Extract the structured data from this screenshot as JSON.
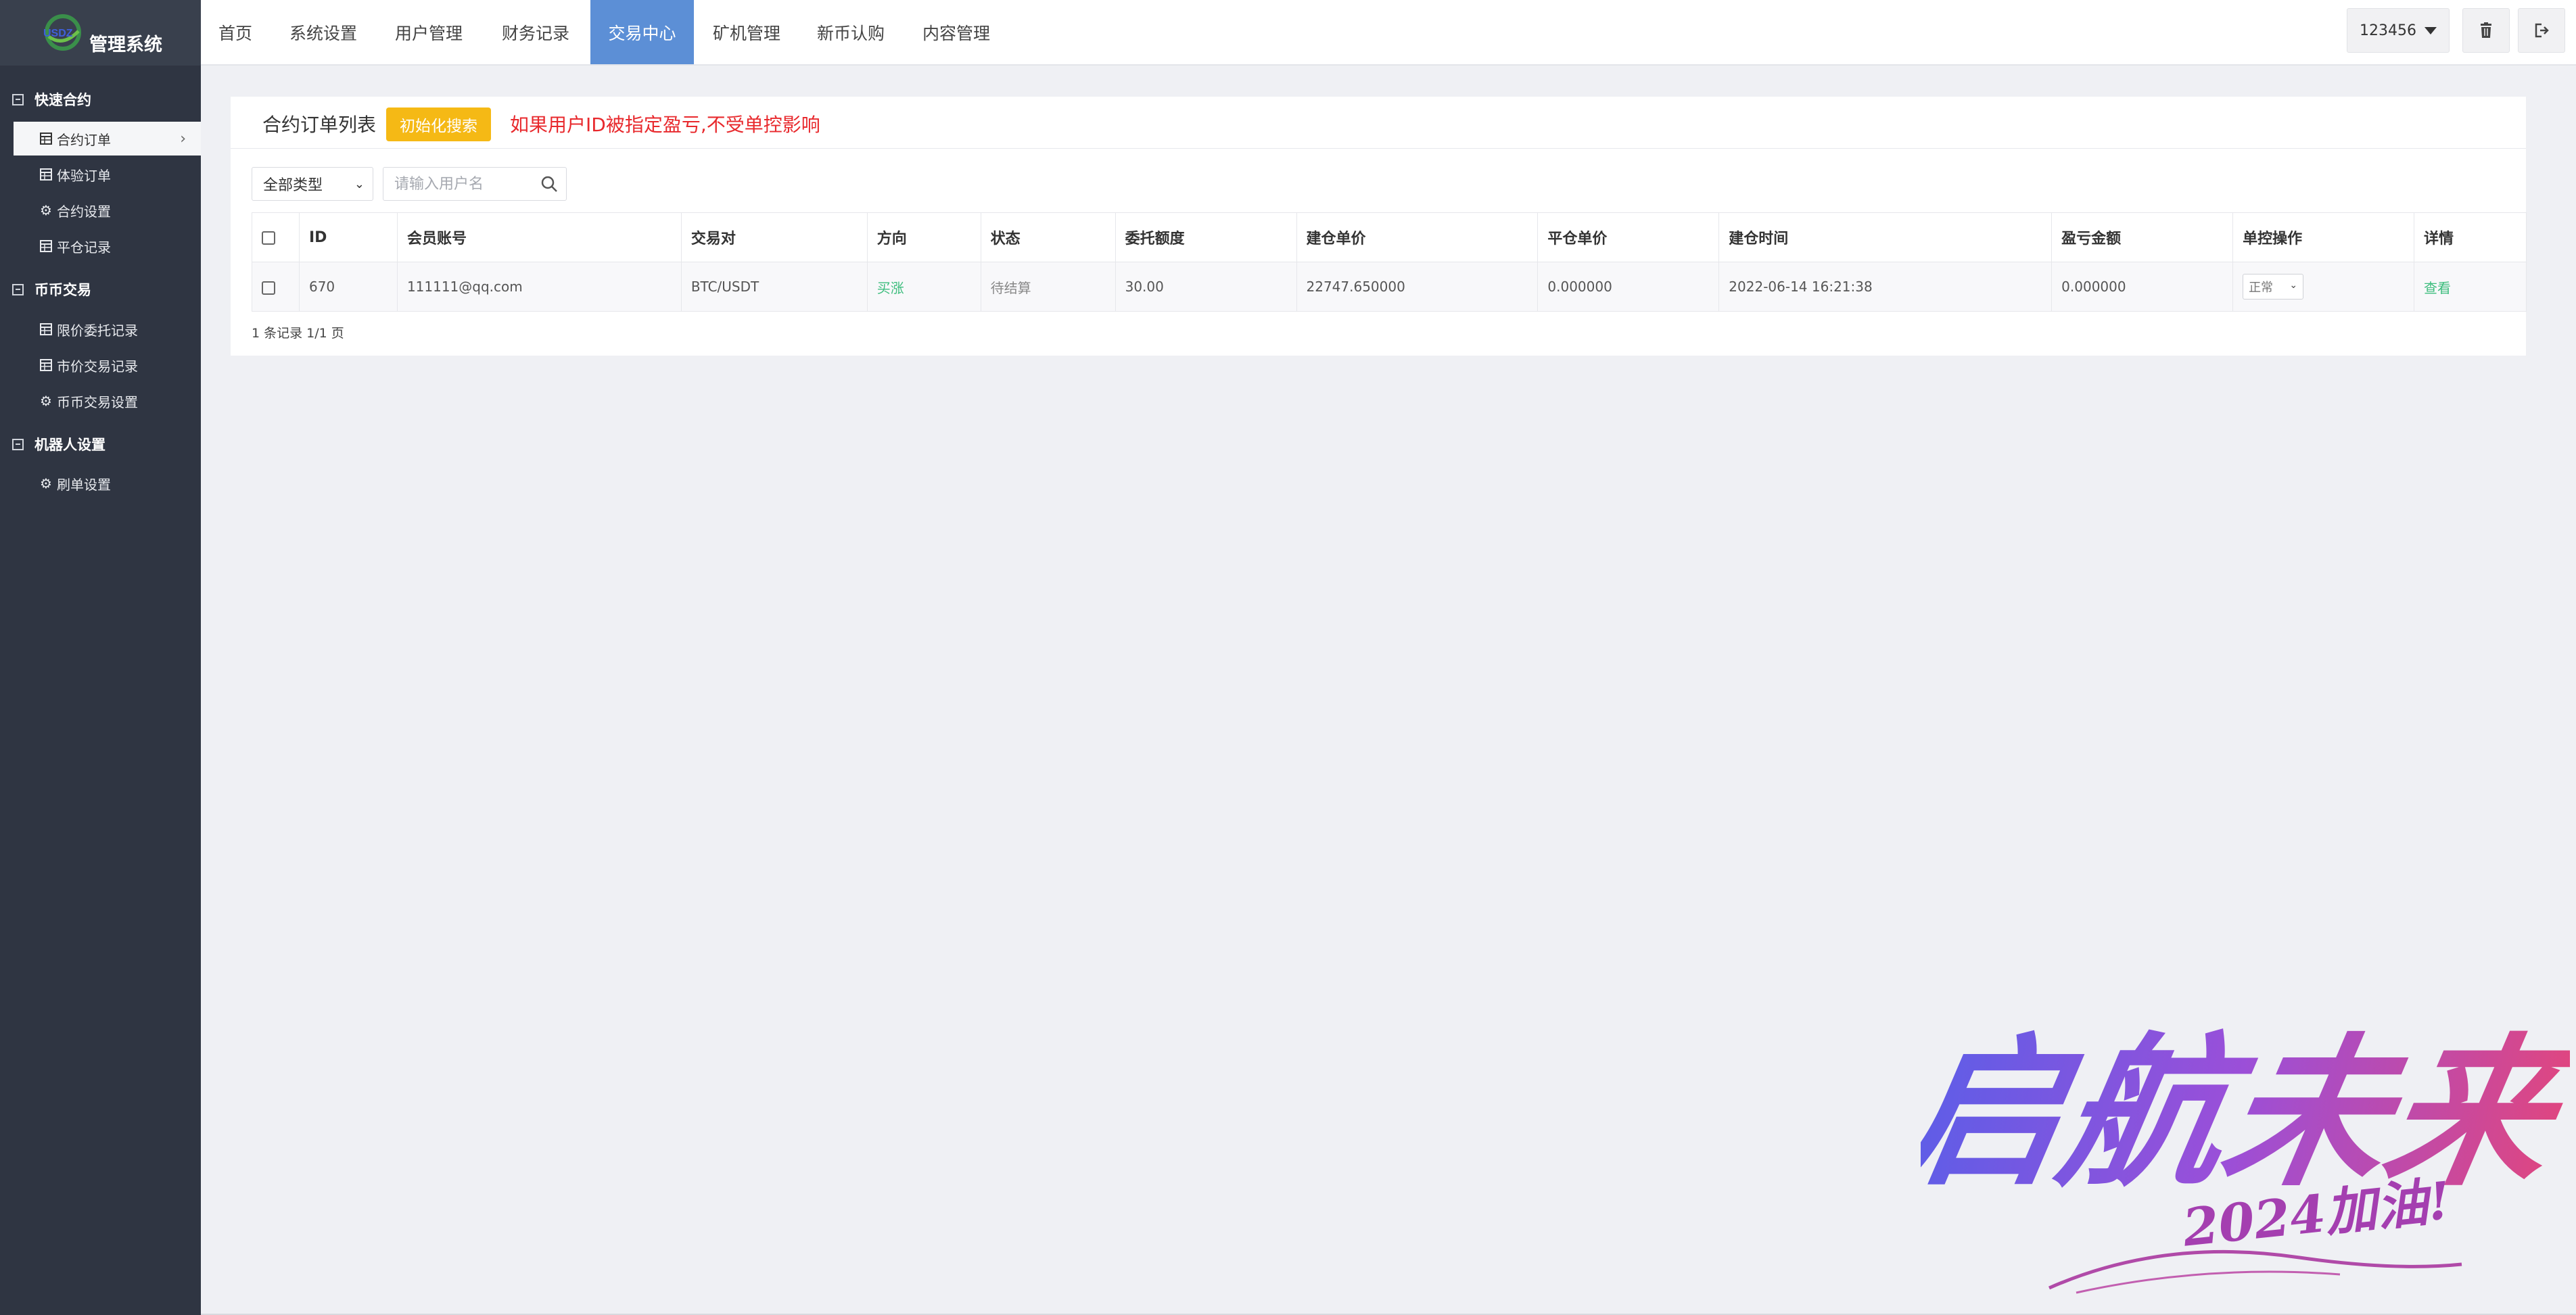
{
  "brand": {
    "logo_text": "USDZ",
    "title": "管理系统"
  },
  "sidebar": {
    "groups": [
      {
        "title": "快速合约",
        "items": [
          {
            "label": "合约订单",
            "icon": "table-icon",
            "active": true
          },
          {
            "label": "体验订单",
            "icon": "table-icon"
          },
          {
            "label": "合约设置",
            "icon": "gear-icon"
          },
          {
            "label": "平仓记录",
            "icon": "table-icon"
          }
        ]
      },
      {
        "title": "币币交易",
        "items": [
          {
            "label": "限价委托记录",
            "icon": "table-icon"
          },
          {
            "label": "市价交易记录",
            "icon": "table-icon"
          },
          {
            "label": "币币交易设置",
            "icon": "gear-icon"
          }
        ]
      },
      {
        "title": "机器人设置",
        "items": [
          {
            "label": "刷单设置",
            "icon": "gear-icon"
          }
        ]
      }
    ]
  },
  "topnav": {
    "items": [
      {
        "label": "首页"
      },
      {
        "label": "系统设置"
      },
      {
        "label": "用户管理"
      },
      {
        "label": "财务记录"
      },
      {
        "label": "交易中心",
        "active": true
      },
      {
        "label": "矿机管理"
      },
      {
        "label": "新币认购"
      },
      {
        "label": "内容管理"
      }
    ],
    "active_color": "#5c8fd6",
    "user": "123456"
  },
  "page": {
    "title": "合约订单列表",
    "reset_label": "初始化搜索",
    "notice": "如果用户ID被指定盈亏,不受单控影响",
    "filter_type": "全部类型",
    "search_placeholder": "请输入用户名",
    "pager": "1 条记录 1/1 页"
  },
  "table": {
    "headers": [
      "ID",
      "会员账号",
      "交易对",
      "方向",
      "状态",
      "委托额度",
      "建仓单价",
      "平仓单价",
      "建仓时间",
      "盈亏金额",
      "单控操作",
      "详情"
    ],
    "rows": [
      {
        "id": "670",
        "account": "111111@qq.com",
        "pair": "BTC/USDT",
        "direction": "买涨",
        "status": "待结算",
        "amount": "30.00",
        "open_price": "22747.650000",
        "close_price": "0.000000",
        "open_time": "2022-06-14 16:21:38",
        "profit": "0.000000",
        "control": "正常",
        "detail": "查看"
      }
    ]
  },
  "colors": {
    "sidebar_bg": "#2f3542",
    "accent_yellow": "#f5b915",
    "warn_red": "#e8292d",
    "up_green": "#3dbd7d"
  },
  "watermark": {
    "text": "启航未来",
    "subtext": "2024加油!"
  }
}
